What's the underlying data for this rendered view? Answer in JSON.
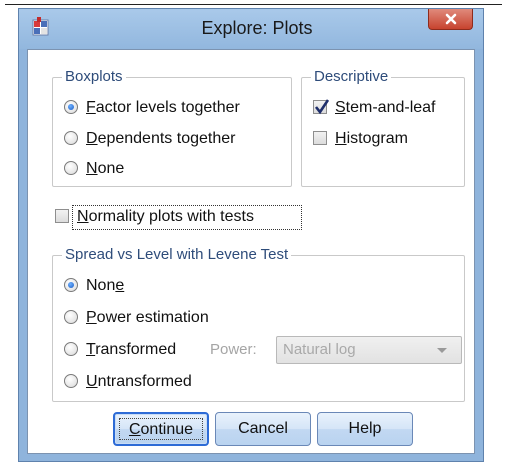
{
  "window": {
    "title": "Explore: Plots",
    "app_icon": "spss-grid-icon",
    "close_icon": "close-x-icon"
  },
  "boxplots": {
    "legend": "Boxplots",
    "options": [
      {
        "access_key": "F",
        "rest": "actor levels together",
        "checked": true
      },
      {
        "access_key": "D",
        "rest": "ependents together",
        "checked": false
      },
      {
        "access_key": "N",
        "rest": "one",
        "checked": false
      }
    ]
  },
  "descriptive": {
    "legend": "Descriptive",
    "stem_and_leaf": {
      "access_key": "S",
      "rest": "tem-and-leaf",
      "checked": true
    },
    "histogram": {
      "access_key": "H",
      "rest": "istogram",
      "checked": false
    }
  },
  "normality": {
    "access_key": "N",
    "rest": "ormality plots with tests",
    "checked": false
  },
  "spread": {
    "legend": "Spread vs Level with Levene Test",
    "none": {
      "prefix": "Non",
      "access_key": "e",
      "checked": true
    },
    "power_estimation": {
      "access_key": "P",
      "rest": "ower estimation",
      "checked": false
    },
    "transformed": {
      "access_key": "T",
      "rest": "ransformed",
      "checked": false
    },
    "untransformed": {
      "access_key": "U",
      "rest": "ntransformed",
      "checked": false
    },
    "power_label": "Power:",
    "power_value": "Natural log"
  },
  "buttons": {
    "continue": {
      "access_key": "C",
      "rest": "ontinue"
    },
    "cancel": "Cancel",
    "help": "Help"
  },
  "colors": {
    "frame": "#8fb4dc",
    "close": "#c7432e",
    "legend_text": "#2e4c7a",
    "default_button_border": "#2d6bd6"
  }
}
